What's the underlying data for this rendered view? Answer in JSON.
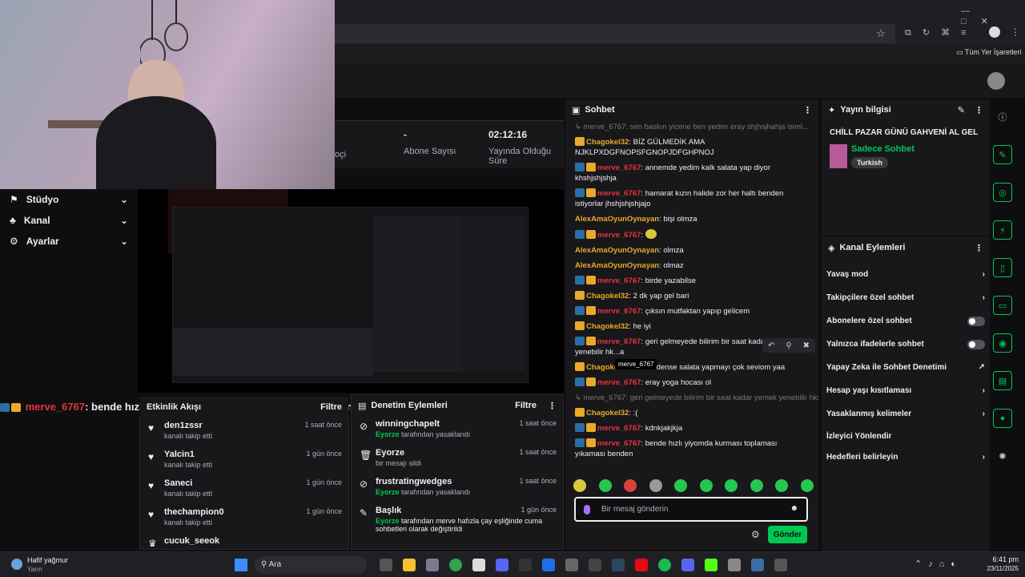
{
  "browser": {
    "bookmarks_label": "Tüm Yer İşaretleri"
  },
  "nav": {
    "items": [
      {
        "label": "Stüdyo"
      },
      {
        "label": "Kanal"
      },
      {
        "label": "Ayarlar"
      }
    ]
  },
  "stats": {
    "partial_label": "oçi",
    "subs_value": "-",
    "subs_label": "Abone Sayısı",
    "uptime_value": "02:12:16",
    "uptime_label": "Yayında Olduğu Süre"
  },
  "overlay_message": {
    "user": "merve_6767",
    "text": ": bende hızlı yiyomda kurması toplaması yıkaması benden"
  },
  "activity": {
    "title": "Etkinlik Akışı",
    "filter_label": "Filtre",
    "items": [
      {
        "name": "den1zssr",
        "sub": "kanalı takip etti",
        "time": "1 saat önce"
      },
      {
        "name": "Yalcin1",
        "sub": "kanalı takip etti",
        "time": "1 gün önce"
      },
      {
        "name": "Saneci",
        "sub": "kanalı takip etti",
        "time": "1 gün önce"
      },
      {
        "name": "thechampion0",
        "sub": "kanalı takip etti",
        "time": "1 gün önce"
      },
      {
        "name": "cucuk_seeok",
        "sub": "",
        "time": ""
      }
    ]
  },
  "moderation": {
    "title": "Denetim Eylemleri",
    "filter_label": "Filtre",
    "items": [
      {
        "name": "winningchapelt",
        "actor": "Eyorze",
        "action": "tarafından yasaklandı",
        "time": "1 saat önce"
      },
      {
        "name": "Eyorze",
        "actor": "",
        "action": "bir mesajı sildi",
        "time": "1 saat önce"
      },
      {
        "name": "frustratingwedges",
        "actor": "Eyorze",
        "action": "tarafından yasaklandı",
        "time": "1 saat önce"
      },
      {
        "name": "Başlık",
        "actor": "Eyorze",
        "action": "tarafından merve hafızla çay eşliğinde cuma sohbetleri olarak değiştirildi",
        "time": "1 gün önce"
      }
    ]
  },
  "chat": {
    "title": "Sohbet",
    "reply_top": "merve_6767: sen baskın yicene ben yedim eray shjhsjhahja",
    "reply_top_tail": "isiml...",
    "messages": [
      {
        "user": "Chagokel32",
        "color": "#e9a92b",
        "badges": "c",
        "text": "BİZ GÜLMEDİK AMA NJKLPXDGFNOPSFGNOPJDFGHPNOJ"
      },
      {
        "user": "merve_6767",
        "color": "#e8323c",
        "badges": "mc",
        "text": "annemde yedim kalk salata yap diyor khshjshjshja"
      },
      {
        "user": "merve_6767",
        "color": "#e8323c",
        "badges": "mc",
        "text": "hamarat kızın halide zor her haltı benden istiyorlar jhshjshjshjajo"
      },
      {
        "user": "AlexAmaOyunOynayan",
        "color": "#e9a92b",
        "badges": "",
        "text": "bişi olmza"
      },
      {
        "user": "merve_6767",
        "color": "#e8323c",
        "badges": "mc",
        "text": ""
      },
      {
        "user": "AlexAmaOyunOynayan",
        "color": "#e9a92b",
        "badges": "",
        "text": "olmza"
      },
      {
        "user": "AlexAmaOyunOynayan",
        "color": "#e9a92b",
        "badges": "",
        "text": "olmaz"
      },
      {
        "user": "merve_6767",
        "color": "#e8323c",
        "badges": "mc",
        "text": "birde yazabilse"
      },
      {
        "user": "Chagokel32",
        "color": "#e9a92b",
        "badges": "c",
        "text": "2 dk yap gel bari"
      },
      {
        "user": "merve_6767",
        "color": "#e8323c",
        "badges": "mc",
        "text": "çıksın mutfaktan yapıp gelicem"
      },
      {
        "user": "Chagokel32",
        "color": "#e9a92b",
        "badges": "c",
        "text": "he iyi"
      },
      {
        "user": "merve_6767",
        "color": "#e8323c",
        "badges": "mc",
        "text": "geri gelmeyede bilirim bir saat kadar yemek yenebilir hk...a"
      },
      {
        "user": "Chagokel32",
        "color": "#e9a92b",
        "badges": "c",
        "text": "ben nedense salata yapmayı çok seviom yaa"
      },
      {
        "user": "merve_6767",
        "color": "#e8323c",
        "badges": "mc",
        "text": "eray yoga hocası ol"
      }
    ],
    "reply_mid": "merve_6767: geri gelmeyede bilirim bir saat kadar yemek yenebilir hks...",
    "messages2": [
      {
        "user": "Chagokel32",
        "color": "#e9a92b",
        "badges": "c",
        "text": ":("
      },
      {
        "user": "merve_6767",
        "color": "#e8323c",
        "badges": "mc",
        "text": "kdnkjakjkja"
      },
      {
        "user": "merve_6767",
        "color": "#e8323c",
        "badges": "mc",
        "text": "bende hızlı yiyomda kurması toplaması yıkaması benden"
      }
    ],
    "tooltip": "merve_6767",
    "input_placeholder": "Bir mesaj gönderin",
    "send_label": "Gönder"
  },
  "stream_info": {
    "title": "Yayın bilgisi",
    "stream_title": "CHİLL PAZAR GÜNÜ GAHVENİ AL GEL",
    "category": "Sadece Sohbet",
    "tag": "Turkish"
  },
  "channel_actions": {
    "title": "Kanal Eylemleri",
    "items": [
      {
        "label": "Yavaş mod",
        "control": "arrow"
      },
      {
        "label": "Takipçilere özel sohbet",
        "control": "arrow"
      },
      {
        "label": "Abonelere özel sohbet",
        "control": "toggle"
      },
      {
        "label": "Yalnızca ifadelerle sohbet",
        "control": "toggle"
      },
      {
        "label": "Yapay Zeka ile Sohbet Denetimi",
        "control": "external"
      },
      {
        "label": "Hesap yaşı kısıtlaması",
        "control": "arrow"
      },
      {
        "label": "Yasaklanmış kelimeler",
        "control": "arrow"
      },
      {
        "label": "İzleyici Yönlendir",
        "control": "none"
      },
      {
        "label": "Hedefleri belirleyin",
        "control": "arrow"
      }
    ]
  },
  "taskbar": {
    "weather_title": "Hafif yağmur",
    "weather_sub": "Yarın",
    "search_label": "Ara",
    "time": "6:41 pm",
    "date": "23/11/2025"
  },
  "colors": {
    "accent": "#00c853",
    "mention": "#e8323c",
    "gold": "#e9a92b"
  }
}
